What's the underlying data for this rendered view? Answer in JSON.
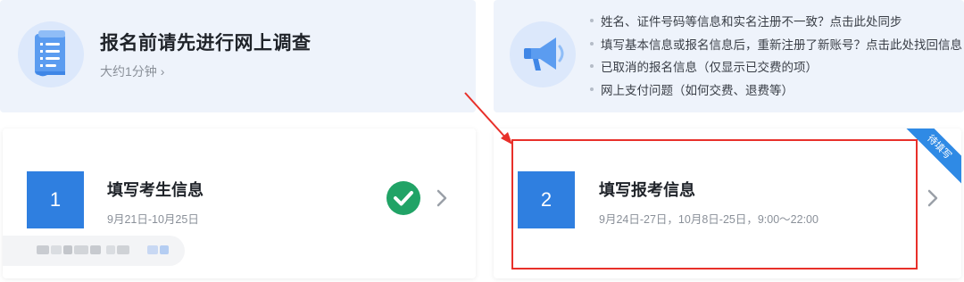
{
  "survey": {
    "title": "报名前请先进行网上调查",
    "subtitle": "大约1分钟",
    "icon": "document-list-icon"
  },
  "help": {
    "icon": "megaphone-icon",
    "items": [
      "姓名、证件号码等信息和实名注册不一致？点击此处同步",
      "填写基本信息或报名信息后，重新注册了新账号？点击此处找回信息",
      "已取消的报名信息（仅显示已交费的项）",
      "网上支付问题（如何交费、退费等）"
    ]
  },
  "steps": [
    {
      "number": "1",
      "title": "填写考生信息",
      "dates": "9月21日-10月25日",
      "status_icon": "check-circle-icon"
    },
    {
      "number": "2",
      "title": "填写报考信息",
      "dates": "9月24日-27日，10月8日-25日，9:00～22:00",
      "ribbon": "待填写"
    }
  ],
  "colors": {
    "panel_bg": "#eef3fb",
    "step_blue": "#2f7fe0",
    "check_green": "#21a366",
    "annotation_red": "#e8302a",
    "ribbon_blue": "#2f8ae5"
  }
}
